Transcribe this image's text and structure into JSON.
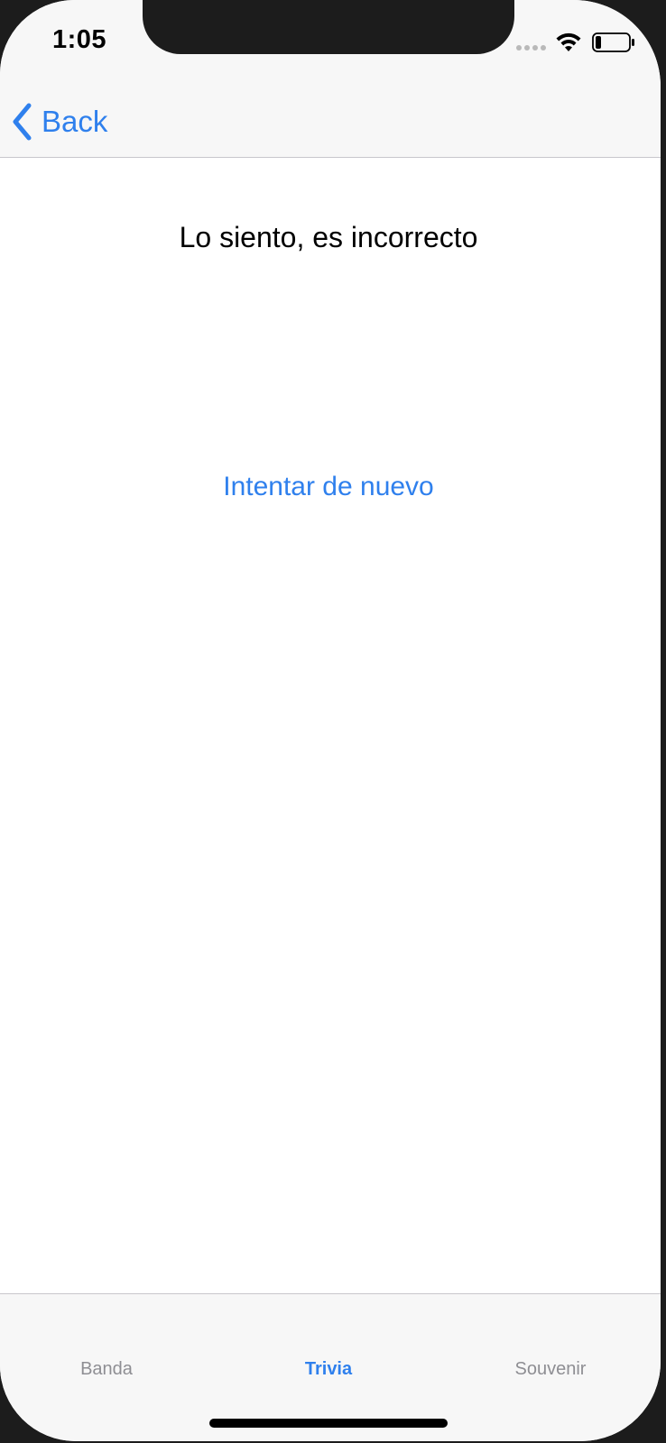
{
  "status_bar": {
    "time": "1:05",
    "signal_icon": "cellular-signal-icon",
    "wifi_icon": "wifi-icon",
    "battery_icon": "battery-icon",
    "battery_level_percent": 20
  },
  "nav": {
    "back_label": "Back",
    "back_icon": "chevron-left-icon"
  },
  "main": {
    "message": "Lo siento, es incorrecto",
    "retry_label": "Intentar de nuevo"
  },
  "tabs": [
    {
      "label": "Banda",
      "active": false
    },
    {
      "label": "Trivia",
      "active": true
    },
    {
      "label": "Souvenir",
      "active": false
    }
  ],
  "colors": {
    "accent": "#2f80ed",
    "inactive_tab": "#8e8e93",
    "bar_background": "#f7f7f7"
  }
}
